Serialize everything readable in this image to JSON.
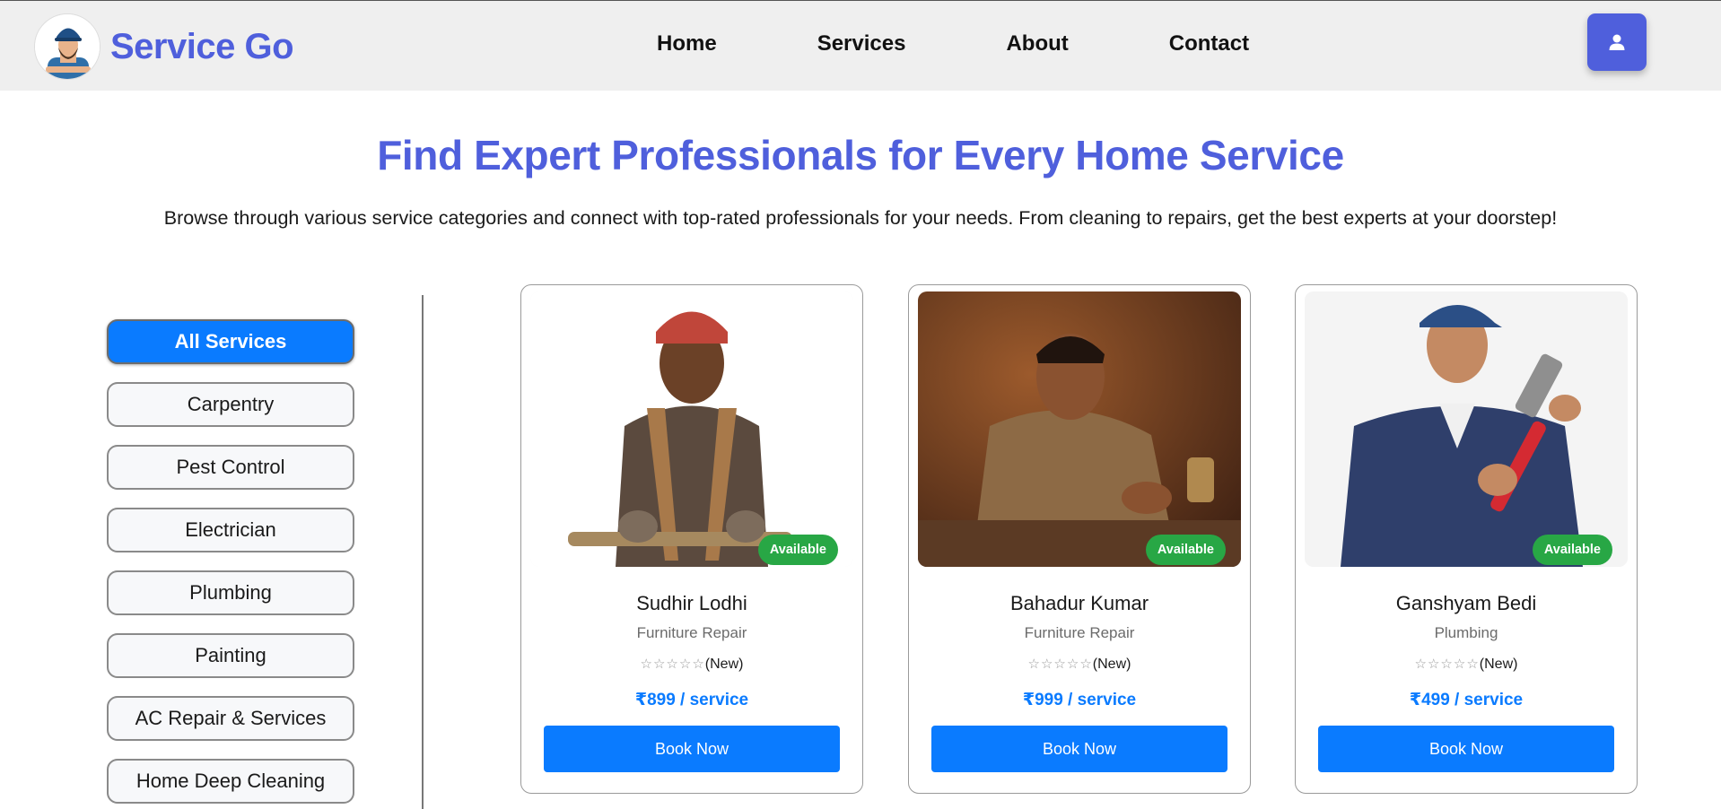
{
  "header": {
    "brand_name": "Service Go",
    "nav": [
      "Home",
      "Services",
      "About",
      "Contact"
    ],
    "profile_icon": "user-icon",
    "brand_color": "#4f5fdc"
  },
  "hero": {
    "title": "Find Expert Professionals for Every Home Service",
    "subtitle": "Browse through various service categories and connect with top-rated professionals for your needs. From cleaning to repairs, get the best experts at your doorstep!"
  },
  "categories": {
    "active": "All Services",
    "items": [
      "All Services",
      "Carpentry",
      "Pest Control",
      "Electrician",
      "Plumbing",
      "Painting",
      "AC Repair & Services",
      "Home Deep Cleaning"
    ]
  },
  "professionals": [
    {
      "name": "Sudhir Lodhi",
      "service": "Furniture Repair",
      "stars": "☆☆☆☆☆",
      "rating_label": "(New)",
      "price": "₹899 / service",
      "badge": "Available",
      "button": "Book Now"
    },
    {
      "name": "Bahadur Kumar",
      "service": "Furniture Repair",
      "stars": "☆☆☆☆☆",
      "rating_label": "(New)",
      "price": "₹999 / service",
      "badge": "Available",
      "button": "Book Now"
    },
    {
      "name": "Ganshyam Bedi",
      "service": "Plumbing",
      "stars": "☆☆☆☆☆",
      "rating_label": "(New)",
      "price": "₹499 / service",
      "badge": "Available",
      "button": "Book Now"
    }
  ],
  "colors": {
    "primary_blue": "#0a7bff",
    "available_green": "#28a745"
  }
}
